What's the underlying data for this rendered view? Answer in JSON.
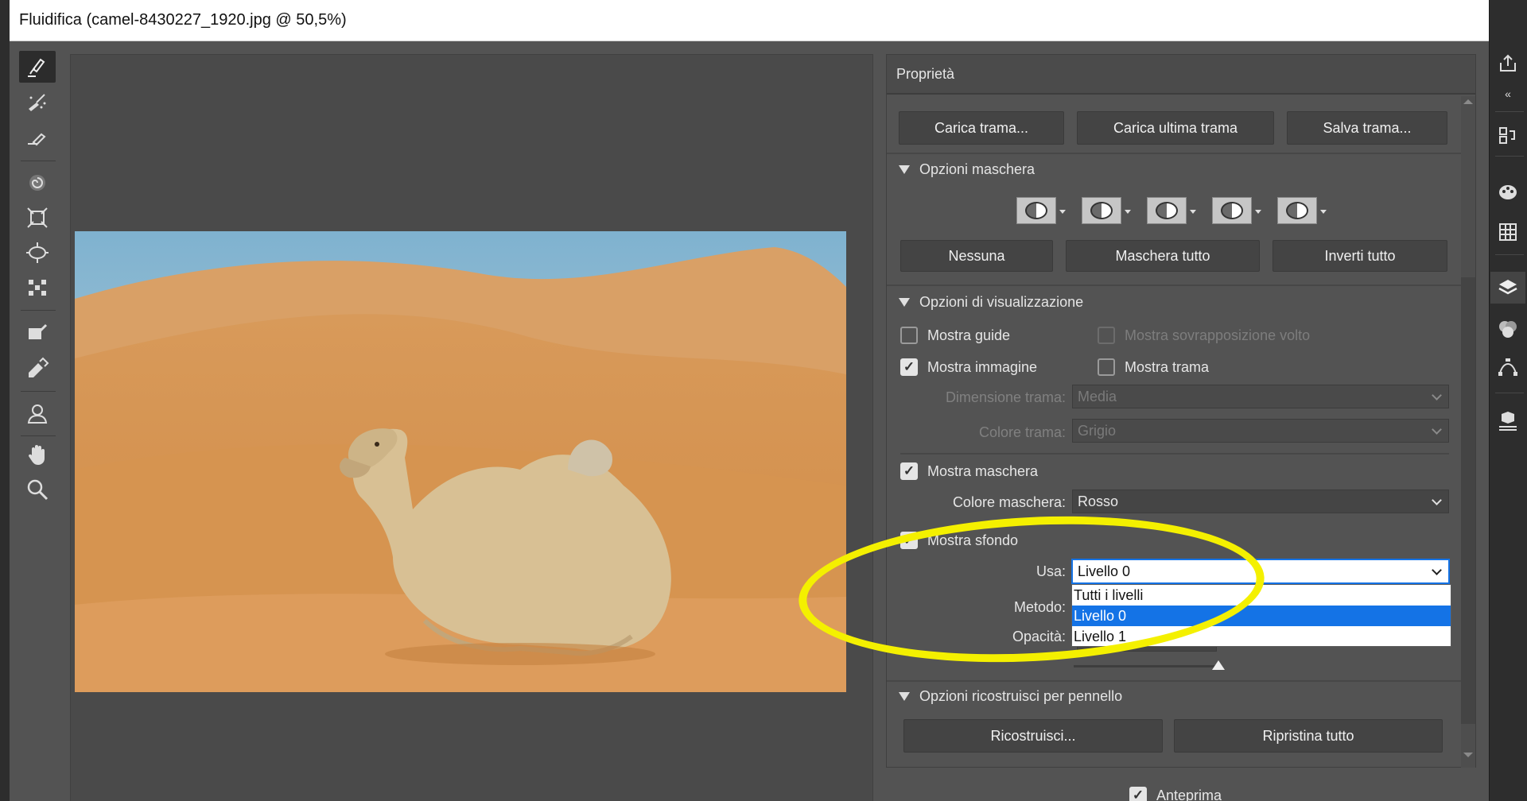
{
  "window": {
    "title": "Fluidifica (camel-8430227_1920.jpg @ 50,5%)"
  },
  "panel": {
    "title": "Proprietà",
    "buttons": {
      "load_mesh": "Carica trama...",
      "load_last_mesh": "Carica ultima trama",
      "save_mesh": "Salva trama..."
    },
    "mask_options": {
      "title": "Opzioni maschera",
      "icons": [
        "mask-replace-icon",
        "mask-add-icon",
        "mask-subtract-icon",
        "mask-intersect-icon",
        "mask-invert-icon"
      ],
      "none": "Nessuna",
      "mask_all": "Maschera tutto",
      "invert_all": "Inverti tutto"
    },
    "view_options": {
      "title": "Opzioni di visualizzazione",
      "show_guides": "Mostra guide",
      "show_face_overlay": "Mostra sovrapposizione volto",
      "show_image": "Mostra immagine",
      "show_mesh": "Mostra trama",
      "mesh_size_label": "Dimensione trama:",
      "mesh_size_value": "Media",
      "mesh_color_label": "Colore trama:",
      "mesh_color_value": "Grigio",
      "show_mask": "Mostra maschera",
      "mask_color_label": "Colore maschera:",
      "mask_color_value": "Rosso",
      "show_backdrop": "Mostra sfondo",
      "use_label": "Usa:",
      "use_value": "Livello 0",
      "use_options": [
        "Tutti i livelli",
        "Livello 0",
        "Livello 1"
      ],
      "mode_label": "Metodo:",
      "opacity_label": "Opacità:"
    },
    "reconstruct": {
      "title": "Opzioni ricostruisci per pennello",
      "reconstruct": "Ricostruisci...",
      "restore_all": "Ripristina tutto"
    },
    "preview": "Anteprima"
  },
  "toolbar": {
    "tools": [
      "forward-warp-icon",
      "reconstruct-tool-icon",
      "smooth-tool-icon",
      "twirl-clockwise-icon",
      "pucker-icon",
      "bloat-icon",
      "push-left-icon",
      "freeze-mask-icon",
      "thaw-mask-icon",
      "face-tool-icon",
      "hand-icon",
      "zoom-icon"
    ]
  },
  "colors": {
    "highlight": "#1473e6",
    "annotation": "#f4f000",
    "panel": "#535353"
  }
}
